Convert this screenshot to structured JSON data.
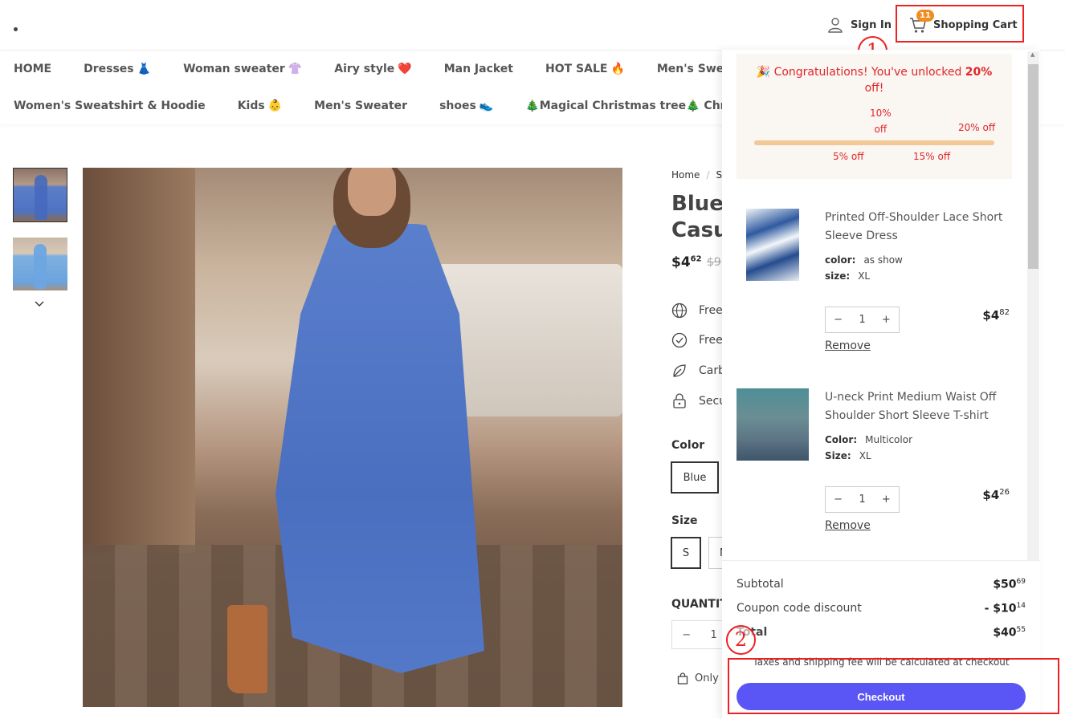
{
  "header": {
    "signin_label": "Sign In",
    "cart_label": "Shopping Cart",
    "cart_count": "11"
  },
  "annotations": {
    "one": "1",
    "two": "2"
  },
  "nav": {
    "row1": [
      {
        "label": "HOME",
        "emoji": ""
      },
      {
        "label": "Dresses",
        "emoji": "👗"
      },
      {
        "label": "Woman sweater",
        "emoji": "👚"
      },
      {
        "label": "Airy style",
        "emoji": "❤️"
      },
      {
        "label": "Man Jacket",
        "emoji": ""
      },
      {
        "label": "HOT SALE",
        "emoji": "🔥"
      },
      {
        "label": "Men's Sweatshirt",
        "emoji": ""
      }
    ],
    "row2": [
      {
        "label": "Women's Sweatshirt & Hoodie",
        "emoji": ""
      },
      {
        "label": "Kids",
        "emoji": "👶"
      },
      {
        "label": "Men's Sweater",
        "emoji": ""
      },
      {
        "label": "shoes",
        "emoji": "👟"
      },
      {
        "label": "🎄Magical Christmas tree🎄 Christmas L",
        "emoji": ""
      }
    ]
  },
  "product": {
    "breadcrumb_home": "Home",
    "breadcrumb_next": "S",
    "title_line1": "Blue",
    "title_line2": "Casu",
    "price_main": "$4",
    "price_cents": "62",
    "price_old": "$9",
    "features": [
      "Free",
      "Free",
      "Carb",
      "Secu"
    ],
    "color_label": "Color",
    "color_selected": "Blue",
    "size_label": "Size",
    "size_selected": "S",
    "size_next": "M",
    "quantity_label": "QUANTIT",
    "quantity_value": "1",
    "only_text": "Only"
  },
  "promo": {
    "message_prefix": "🎉 Congratulations! You've unlocked ",
    "message_bold": "20%",
    "message_suffix": " off!",
    "tier_10": "10%\noff",
    "tier_20": "20% off",
    "tier_5": "5% off",
    "tier_15": "15% off",
    "progress_fraction": 1.0
  },
  "cart_items": [
    {
      "name": "Printed Off-Shoulder Lace Short Sleeve Dress",
      "attr1_label": "color:",
      "attr1_value": "as show",
      "attr2_label": "size:",
      "attr2_value": "XL",
      "qty": "1",
      "price_main": "$4",
      "price_cents": "82",
      "remove_label": "Remove"
    },
    {
      "name": "U-neck Print Medium Waist Off Shoulder Short Sleeve T-shirt",
      "attr1_label": "Color:",
      "attr1_value": "Multicolor",
      "attr2_label": "Size:",
      "attr2_value": "XL",
      "qty": "1",
      "price_main": "$4",
      "price_cents": "26",
      "remove_label": "Remove"
    }
  ],
  "summary": {
    "subtotal_label": "Subtotal",
    "subtotal_main": "$50",
    "subtotal_cents": "69",
    "coupon_label": "Coupon code discount",
    "coupon_main": "- $10",
    "coupon_cents": "14",
    "total_label": "Total",
    "total_main": "$40",
    "total_cents": "55",
    "tax_note": "Taxes and shipping fee will be calculated at checkout",
    "checkout_label": "Checkout"
  },
  "colors": {
    "accent_checkout": "#5a55f5",
    "promo_red": "#e0262a",
    "badge_orange": "#f28c1e",
    "annotation_red": "#ee2222"
  }
}
